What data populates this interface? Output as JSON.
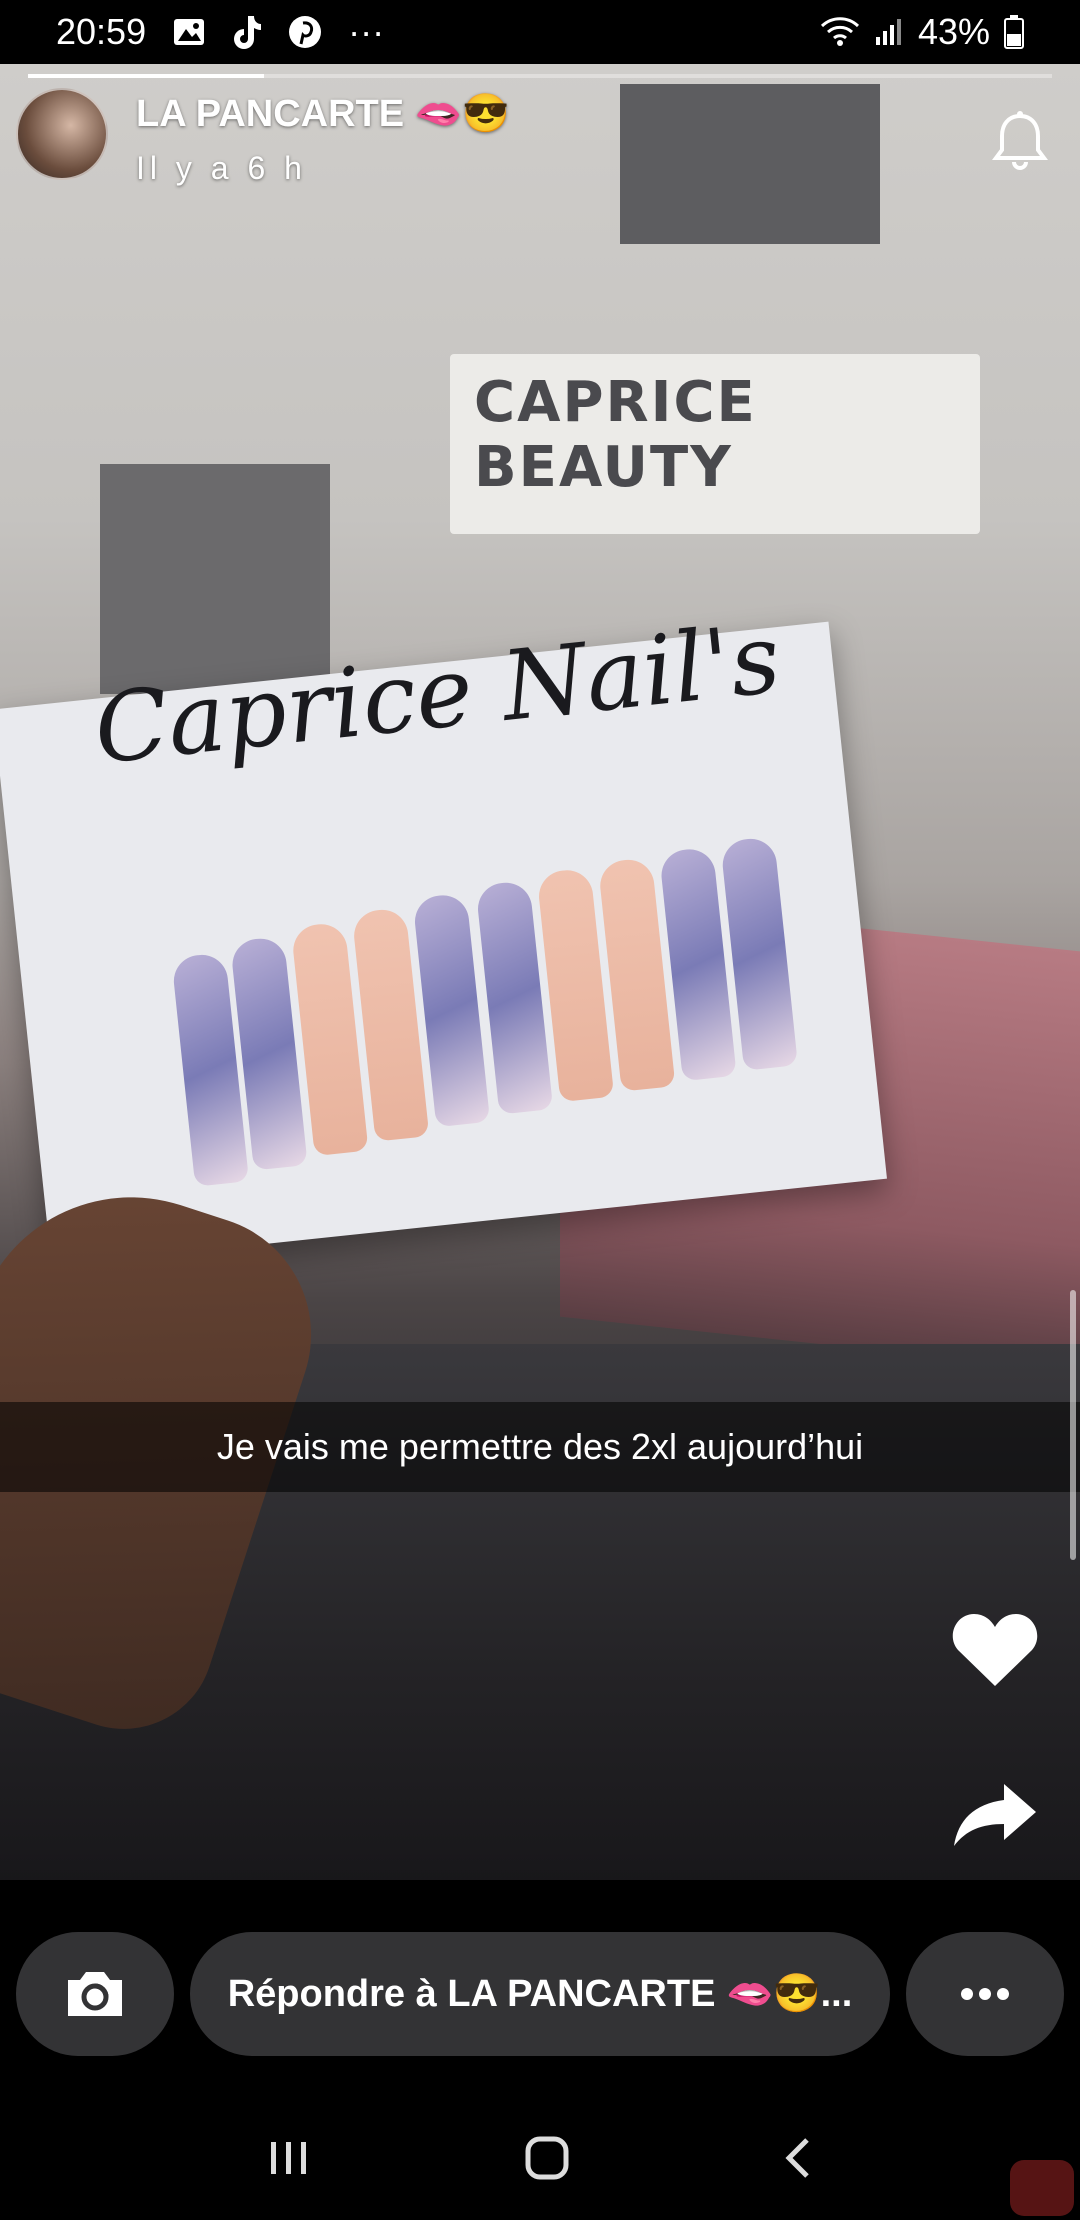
{
  "status_bar": {
    "time": "20:59",
    "more_glyph": "···",
    "battery": "43%",
    "icons": [
      "gallery-icon",
      "tiktok-icon",
      "pinterest-icon",
      "wifi-icon",
      "signal-icon",
      "battery-icon"
    ]
  },
  "story": {
    "progress": 0.23,
    "author": "LA PANCARTE 🫦😎",
    "time_ago": "Il y a 6 h",
    "card_text": "Caprice Nail's",
    "sign_text": "CAPRICE BEAUTY",
    "caption": "Je vais me permettre des 2xl aujourd’hui"
  },
  "reply": {
    "text": "Répondre à LA PANCARTE 🫦😎..."
  },
  "colors": {
    "background": "#000000",
    "pill": "#333335",
    "accent": "#ffffff"
  }
}
